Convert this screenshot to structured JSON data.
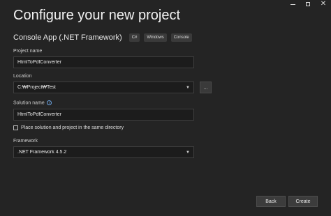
{
  "window": {
    "title": "Configure your new project",
    "controls": {
      "minimize": "minimize",
      "maximize": "maximize",
      "close": "✕"
    }
  },
  "template": {
    "name": "Console App (.NET Framework)",
    "tags": [
      "C#",
      "Windows",
      "Console"
    ]
  },
  "form": {
    "project_name": {
      "label": "Project name",
      "value": "HtmlToPdfConverter"
    },
    "location": {
      "label": "Location",
      "value": "C:₩Project₩Test",
      "browse_label": "..."
    },
    "solution_name": {
      "label": "Solution name",
      "value": "HtmlToPdfConverter",
      "info_glyph": "i"
    },
    "same_directory": {
      "label": "Place solution and project in the same directory",
      "checked": false
    },
    "framework": {
      "label": "Framework",
      "value": ".NET Framework 4.5.2"
    }
  },
  "footer": {
    "back_label": "Back",
    "create_label": "Create"
  }
}
